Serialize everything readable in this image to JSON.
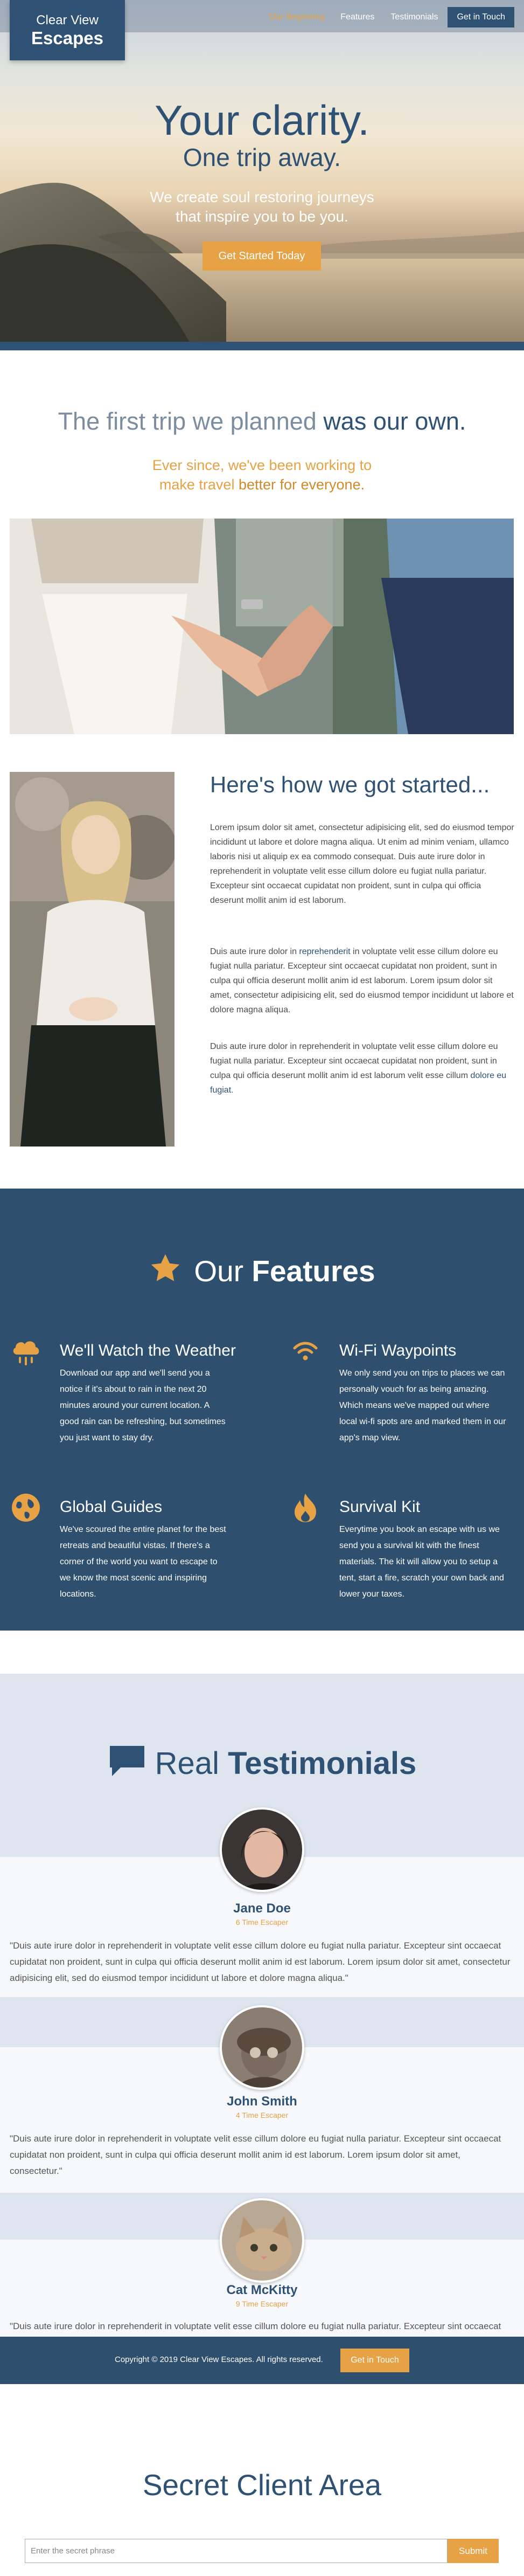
{
  "brand": {
    "line1": "Clear View",
    "line2": "Escapes"
  },
  "nav": {
    "items": [
      "Our Beginning",
      "Features",
      "Testimonials"
    ],
    "cta": "Get in Touch"
  },
  "hero": {
    "title": "Your clarity.",
    "subtitle": "One trip away.",
    "tagline_1": "We create soul restoring journeys",
    "tagline_2": "that inspire you to be you.",
    "button": "Get Started Today"
  },
  "story": {
    "heading_a": "The first trip we planned ",
    "heading_b": "was our own.",
    "sub_line1": "Ever since, we've been working to",
    "sub_line2a": "make travel ",
    "sub_line2b": "better for everyone.",
    "how_heading": "Here's how we got started...",
    "p1": "Lorem ipsum dolor sit amet, consectetur adipisicing elit, sed do eiusmod tempor incididunt ut labore et dolore magna aliqua. Ut enim ad minim veniam, ullamco laboris nisi ut aliquip ex ea commodo consequat. Duis aute irure dolor in reprehenderit in voluptate velit esse cillum dolore eu fugiat nulla pariatur. Excepteur sint occaecat cupidatat non proident, sunt in culpa qui officia deserunt mollit anim id est laborum.",
    "p2a": "Duis aute irure dolor in ",
    "p2b": "reprehenderit",
    "p2c": " in voluptate velit esse cillum dolore eu fugiat nulla pariatur. Excepteur sint occaecat cupidatat non proident, sunt in culpa qui officia deserunt mollit anim id est laborum. Lorem ipsum dolor sit amet, consectetur adipisicing elit, sed do eiusmod tempor incididunt ut labore et dolore magna aliqua.",
    "p3a": "Duis aute irure dolor in reprehenderit in voluptate velit esse cillum dolore eu fugiat nulla pariatur. Excepteur sint occaecat cupidatat non proident, sunt in culpa qui officia deserunt mollit anim id est laborum velit esse cillum ",
    "p3b": "dolore eu fugiat."
  },
  "features": {
    "title_a": "Our ",
    "title_b": "Features",
    "items": [
      {
        "icon": "cloud-rain-icon",
        "title": "We'll Watch the Weather",
        "text": "Download our app and we'll send you a notice if it's about to rain in the next 20 minutes around your current location. A good rain can be refreshing, but sometimes you just want to stay dry."
      },
      {
        "icon": "wifi-icon",
        "title": "Wi-Fi Waypoints",
        "text": "We only send you on trips to places we can personally vouch for as being amazing. Which means we've mapped out where local wi-fi spots are and marked them in our app's map view."
      },
      {
        "icon": "globe-icon",
        "title": "Global Guides",
        "text": "We've scoured the entire planet for the best retreats and beautiful vistas. If there's a corner of the world you want to escape to we know the most scenic and inspiring locations."
      },
      {
        "icon": "fire-icon",
        "title": "Survival Kit",
        "text": "Everytime you book an escape with us we send you a survival kit with the finest materials. The kit will allow you to setup a tent, start a fire, scratch your own back and lower your taxes."
      }
    ]
  },
  "testimonials": {
    "title_a": "Real ",
    "title_b": "Testimonials",
    "items": [
      {
        "name": "Jane Doe",
        "role": "6 Time Escaper",
        "quote": "\"Duis aute irure dolor in reprehenderit in voluptate velit esse cillum dolore eu fugiat nulla pariatur. Excepteur sint occaecat cupidatat non proident, sunt in culpa qui officia deserunt mollit anim id est laborum. Lorem ipsum dolor sit amet, consectetur adipisicing elit, sed do eiusmod tempor incididunt ut labore et dolore magna aliqua.\""
      },
      {
        "name": "John Smith",
        "role": "4 Time Escaper",
        "quote": "\"Duis aute irure dolor in reprehenderit in voluptate velit esse cillum dolore eu fugiat nulla pariatur. Excepteur sint occaecat cupidatat non proident, sunt in culpa qui officia deserunt mollit anim id est laborum. Lorem ipsum dolor sit amet, consectetur.\""
      },
      {
        "name": "Cat McKitty",
        "role": "9 Time Escaper",
        "quote": "\"Duis aute irure dolor in reprehenderit in voluptate velit esse cillum dolore eu fugiat nulla pariatur. Excepteur sint occaecat cupidatat non proident, sunt in culpa qui officia deserunt mollit anim id est laborum. Lorem ipsum dolor sit amet, consectetur adipisicing elit, sed do eiusmod tempor incididunt ut labore.\""
      }
    ]
  },
  "footer": {
    "copyright": "Copyright © 2019 Clear View Escapes. All rights reserved.",
    "cta": "Get in Touch"
  },
  "secret": {
    "title": "Secret Client Area",
    "placeholder": "Enter the secret phrase",
    "button": "Submit"
  },
  "colors": {
    "navy": "#2e5174",
    "accent": "#e6a244",
    "light_panel": "#dfe5ef"
  }
}
